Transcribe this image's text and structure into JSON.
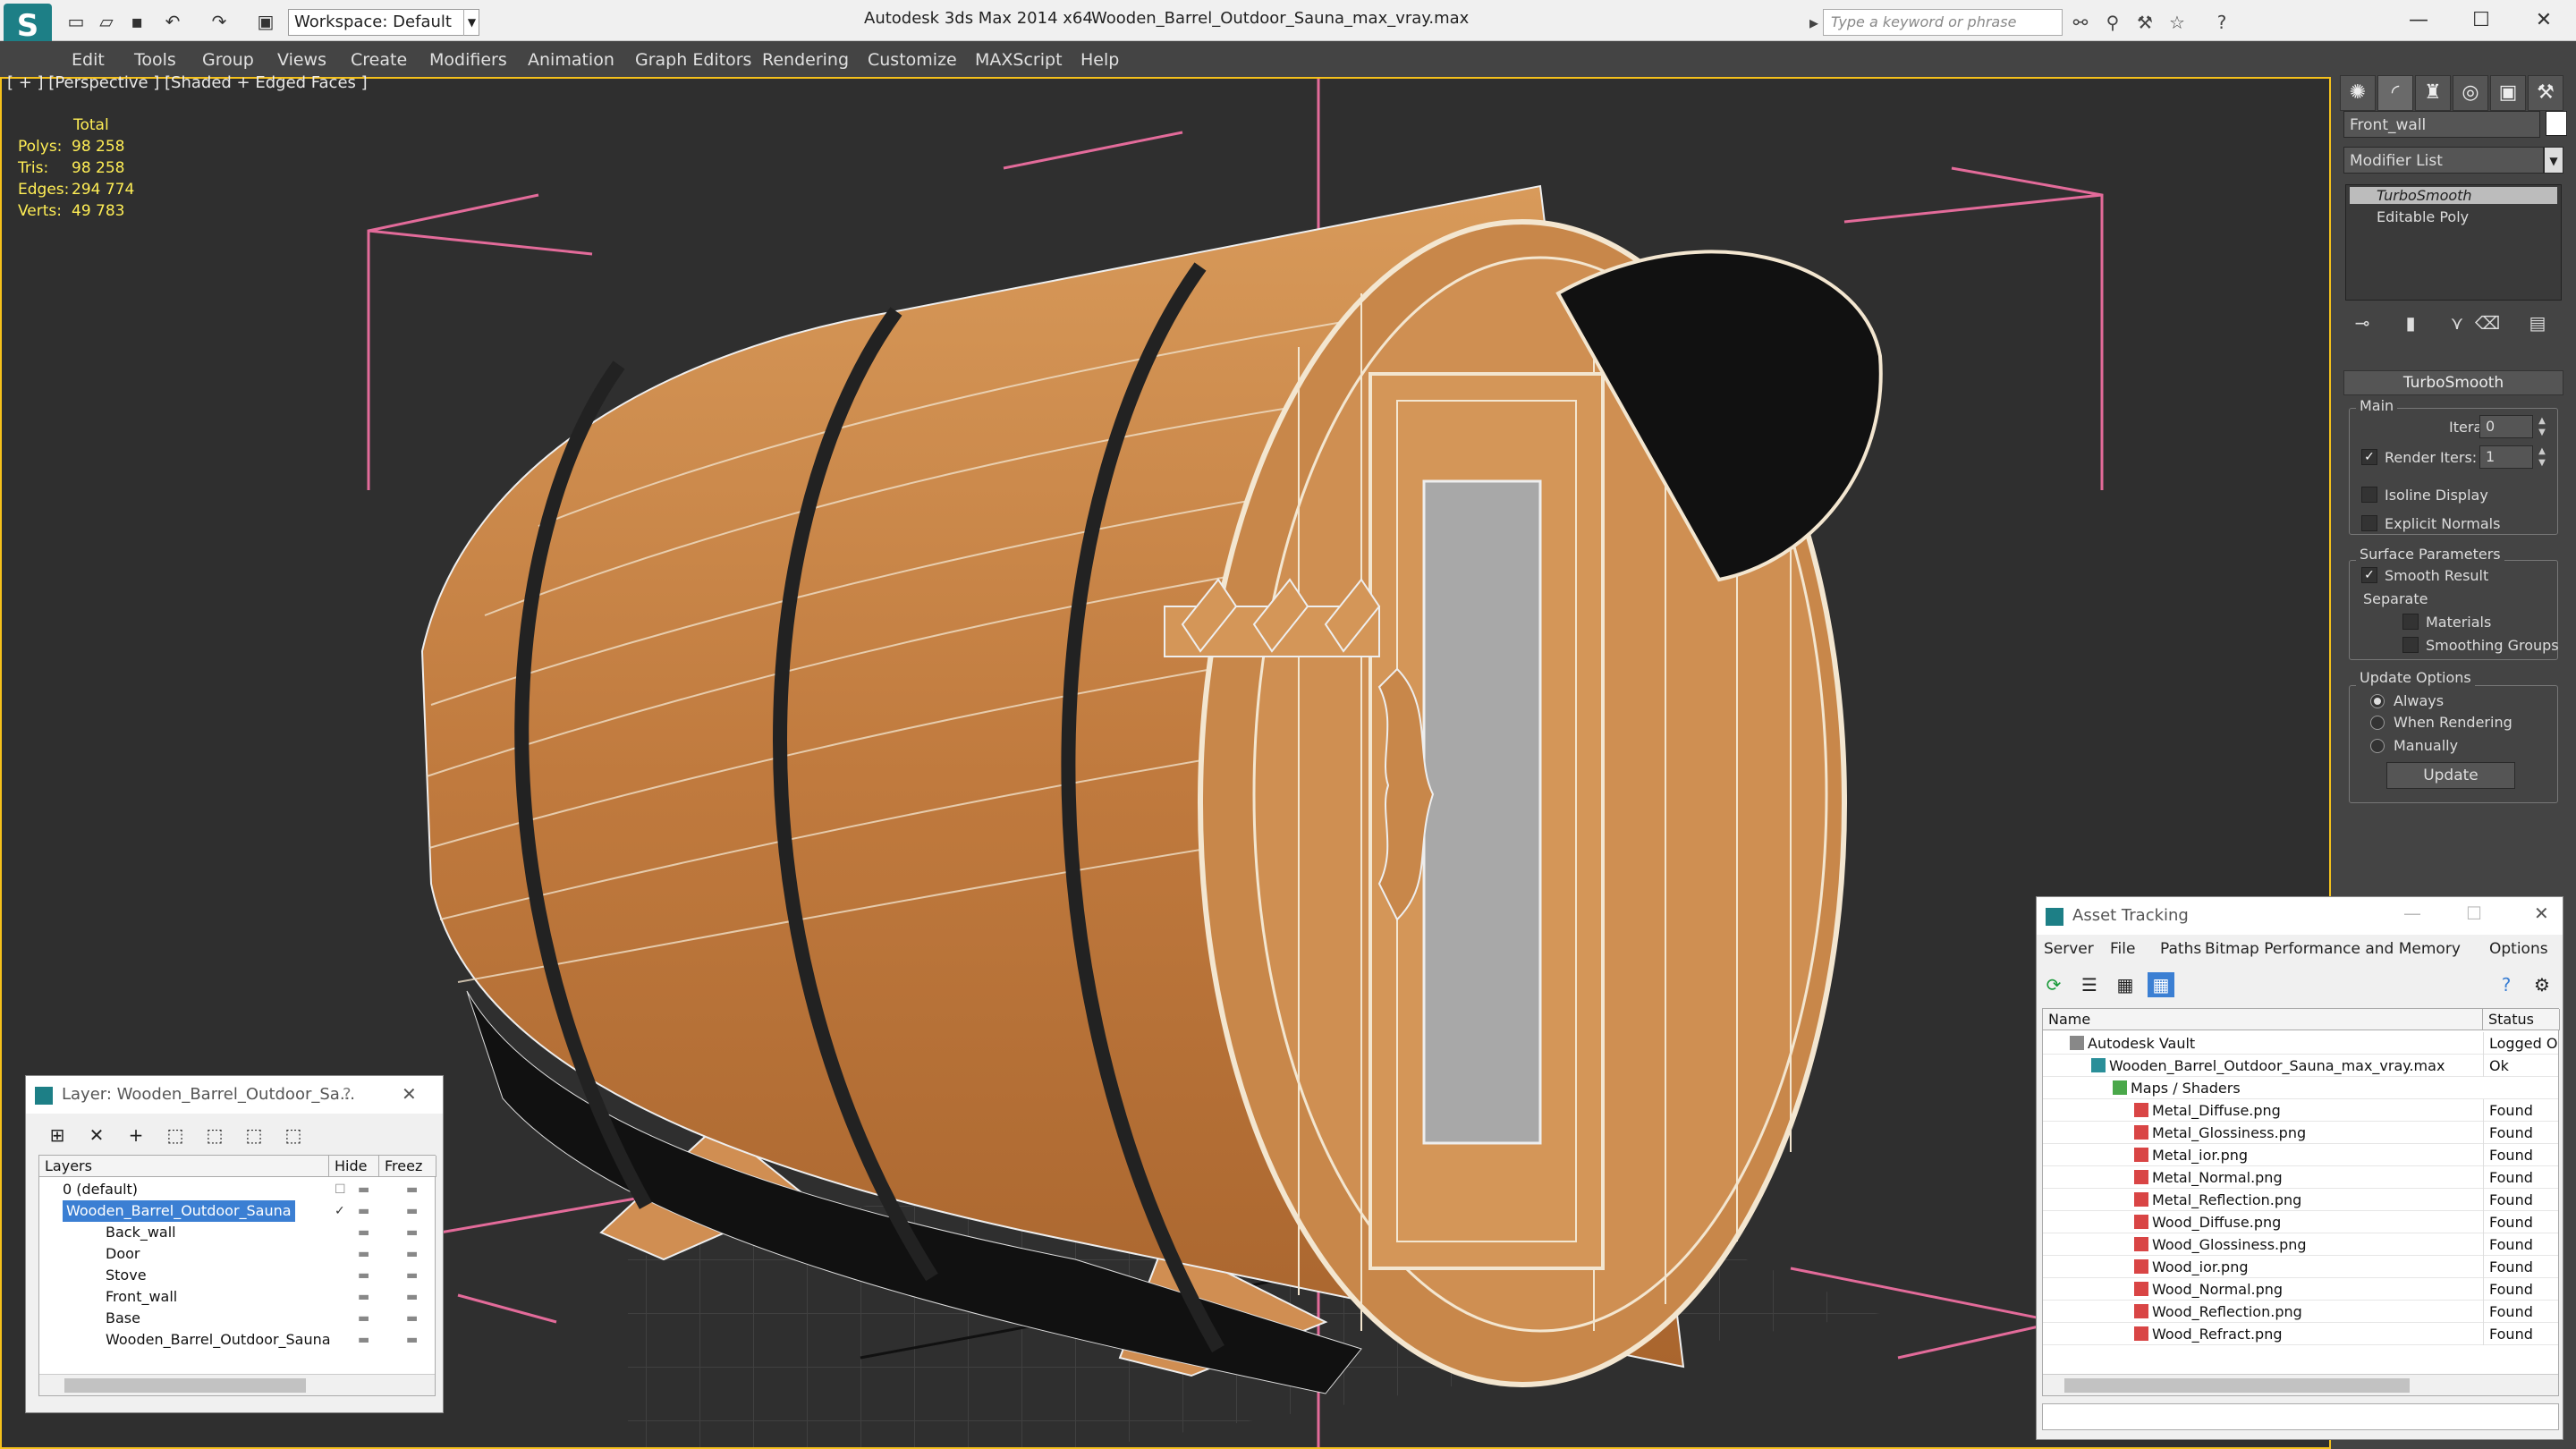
{
  "titlebar": {
    "app_title": "Autodesk 3ds Max  2014 x64",
    "file_title": "Wooden_Barrel_Outdoor_Sauna_max_vray.max",
    "workspace": "Workspace: Default",
    "search_placeholder": "Type a keyword or phrase"
  },
  "menu": [
    "Edit",
    "Tools",
    "Group",
    "Views",
    "Create",
    "Modifiers",
    "Animation",
    "Graph Editors",
    "Rendering",
    "Customize",
    "MAXScript",
    "Help"
  ],
  "viewport": {
    "label": "[ + ] [Perspective ] [Shaded + Edged Faces ]",
    "stats_header": "Total",
    "stats": [
      {
        "label": "Polys:",
        "value": "98 258"
      },
      {
        "label": "Tris:",
        "value": "98 258"
      },
      {
        "label": "Edges:",
        "value": "294 774"
      },
      {
        "label": "Verts:",
        "value": "49 783"
      }
    ]
  },
  "command_panel": {
    "object_name": "Front_wall",
    "modifier_list": "Modifier List",
    "stack": [
      "TurboSmooth",
      "Editable Poly"
    ],
    "rollout_title": "TurboSmooth",
    "main_label": "Main",
    "iterations_label": "Iterations:",
    "iterations_value": "0",
    "render_iters_label": "Render Iters:",
    "render_iters_value": "1",
    "isoline_label": "Isoline Display",
    "explicit_normals_label": "Explicit Normals",
    "surface_params_label": "Surface Parameters",
    "smooth_result_label": "Smooth Result",
    "separate_label": "Separate",
    "materials_label": "Materials",
    "smoothing_groups_label": "Smoothing Groups",
    "update_options_label": "Update Options",
    "always_label": "Always",
    "when_rendering_label": "When Rendering",
    "manually_label": "Manually",
    "update_button": "Update"
  },
  "layer_window": {
    "title": "Layer: Wooden_Barrel_Outdoor_Sa...",
    "help": "?",
    "col_layers": "Layers",
    "col_hide": "Hide",
    "col_freeze": "Freez",
    "rows": [
      "0 (default)",
      "Wooden_Barrel_Outdoor_Sauna",
      "Back_wall",
      "Door",
      "Stove",
      "Front_wall",
      "Base",
      "Wooden_Barrel_Outdoor_Sauna"
    ]
  },
  "asset_window": {
    "title": "Asset Tracking",
    "menu": [
      "Server",
      "File",
      "Paths",
      "Bitmap Performance and Memory",
      "Options"
    ],
    "col_name": "Name",
    "col_status": "Status",
    "rows": [
      {
        "name": "Autodesk Vault",
        "status": "Logged Out"
      },
      {
        "name": "Wooden_Barrel_Outdoor_Sauna_max_vray.max",
        "status": "Ok"
      },
      {
        "name": "Maps / Shaders",
        "status": ""
      },
      {
        "name": "Metal_Diffuse.png",
        "status": "Found"
      },
      {
        "name": "Metal_Glossiness.png",
        "status": "Found"
      },
      {
        "name": "Metal_ior.png",
        "status": "Found"
      },
      {
        "name": "Metal_Normal.png",
        "status": "Found"
      },
      {
        "name": "Metal_Reflection.png",
        "status": "Found"
      },
      {
        "name": "Wood_Diffuse.png",
        "status": "Found"
      },
      {
        "name": "Wood_Glossiness.png",
        "status": "Found"
      },
      {
        "name": "Wood_ior.png",
        "status": "Found"
      },
      {
        "name": "Wood_Normal.png",
        "status": "Found"
      },
      {
        "name": "Wood_Reflection.png",
        "status": "Found"
      },
      {
        "name": "Wood_Refract.png",
        "status": "Found"
      }
    ]
  },
  "colors": {
    "viewport_bg": "#2f2f2f",
    "stats_text": "#ffee55",
    "wood": "#c8874a",
    "selection": "#3b7fd3"
  }
}
